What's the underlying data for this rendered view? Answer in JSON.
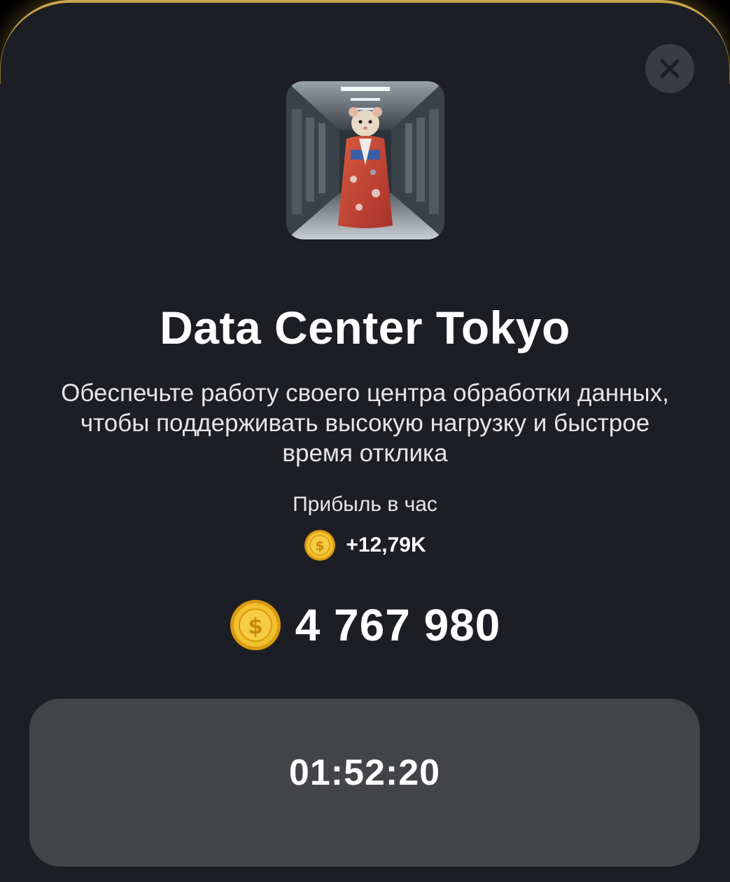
{
  "card": {
    "title": "Data Center Tokyo",
    "description": "Обеспечьте работу своего центра обработки данных, чтобы поддерживать высокую нагрузку и быстрое время отклика",
    "image_icon": "hamster-in-kimono-datacenter-image"
  },
  "profit": {
    "label": "Прибыль в час",
    "value": "+12,79K",
    "icon": "coin-icon"
  },
  "balance": {
    "value": "4 767 980",
    "icon": "coin-icon"
  },
  "action": {
    "timer": "01:52:20"
  },
  "close": {
    "icon": "close-icon"
  },
  "colors": {
    "background": "#1c1e23",
    "accent_border": "#c9a44c",
    "coin": "#f2c12e",
    "button": "#434447"
  }
}
